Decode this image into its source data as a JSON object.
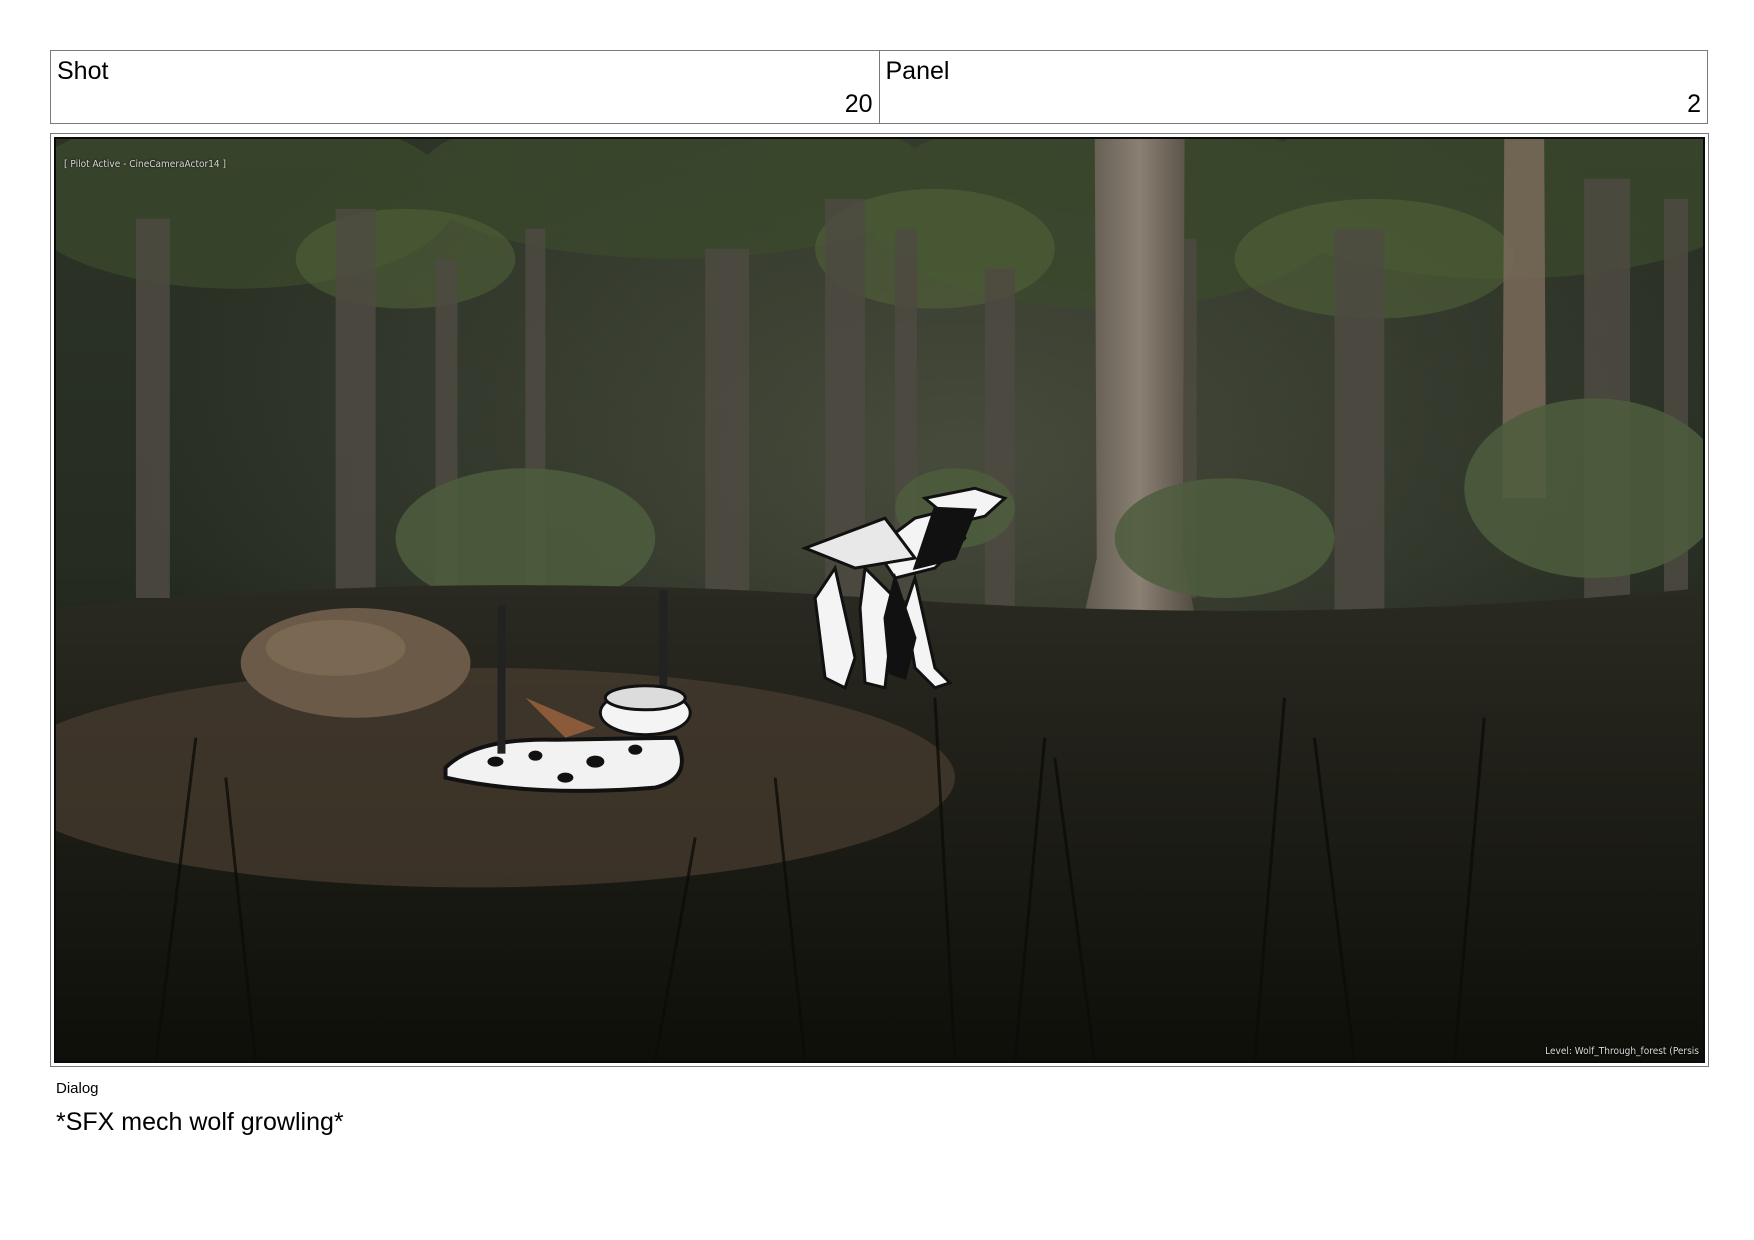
{
  "header": {
    "shot_label": "Shot",
    "shot_value": "20",
    "panel_label": "Panel",
    "panel_value": "2"
  },
  "panel_image": {
    "overlay_top_left": "[ Pilot Active - CineCameraActor14 ]",
    "overlay_bottom_right": "Level:  Wolf_Through_forest (Persis"
  },
  "dialog": {
    "label": "Dialog",
    "text": "*SFX mech wolf growling*"
  }
}
